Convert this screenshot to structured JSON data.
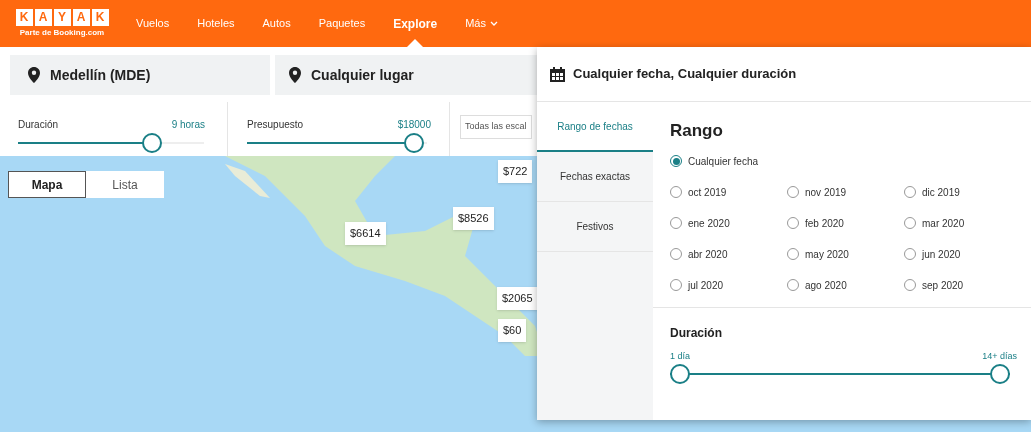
{
  "header": {
    "logo_letters": [
      "K",
      "A",
      "Y",
      "A",
      "K"
    ],
    "logo_tagline": "Parte de Booking.com",
    "nav": [
      {
        "label": "Vuelos",
        "selected": false,
        "kind": "link"
      },
      {
        "label": "Hoteles",
        "selected": false,
        "kind": "link"
      },
      {
        "label": "Autos",
        "selected": false,
        "kind": "link"
      },
      {
        "label": "Paquetes",
        "selected": false,
        "kind": "link"
      },
      {
        "label": "Explore",
        "selected": true,
        "kind": "link"
      },
      {
        "label": "Más",
        "selected": false,
        "kind": "menu"
      }
    ]
  },
  "search": {
    "origin": "Medellín (MDE)",
    "destination": "Cualquier lugar"
  },
  "filters": {
    "duration": {
      "label": "Duración",
      "reading": "9 horas",
      "level": 0.72
    },
    "budget": {
      "label": "Presupuesto",
      "reading": "$18000",
      "level": 0.93
    },
    "stops": "Todas las escal"
  },
  "view_toggle": [
    {
      "label": "Mapa",
      "selected": true
    },
    {
      "label": "Lista",
      "selected": false
    }
  ],
  "map": {
    "price_pins": [
      "$722",
      "$8526",
      "$6614",
      "$2065",
      "$60"
    ]
  },
  "date_panel": {
    "title": "Cualquier fecha, Cualquier duración",
    "tabs": [
      {
        "label": "Rango de fechas",
        "selected": true
      },
      {
        "label": "Fechas exactas",
        "selected": false
      },
      {
        "label": "Festivos",
        "selected": false
      }
    ],
    "range_heading": "Rango",
    "any_date": {
      "label": "Cualquier fecha",
      "selected": true
    },
    "months": [
      {
        "label": "oct 2019",
        "selected": false
      },
      {
        "label": "nov 2019",
        "selected": false
      },
      {
        "label": "dic 2019",
        "selected": false
      },
      {
        "label": "ene 2020",
        "selected": false
      },
      {
        "label": "feb 2020",
        "selected": false
      },
      {
        "label": "mar 2020",
        "selected": false
      },
      {
        "label": "abr 2020",
        "selected": false
      },
      {
        "label": "may 2020",
        "selected": false
      },
      {
        "label": "jun 2020",
        "selected": false
      },
      {
        "label": "jul 2020",
        "selected": false
      },
      {
        "label": "ago 2020",
        "selected": false
      },
      {
        "label": "sep 2020",
        "selected": false
      }
    ],
    "duration": {
      "heading": "Duración",
      "min_label": "1 día",
      "max_label": "14+ días",
      "level": 1
    }
  }
}
